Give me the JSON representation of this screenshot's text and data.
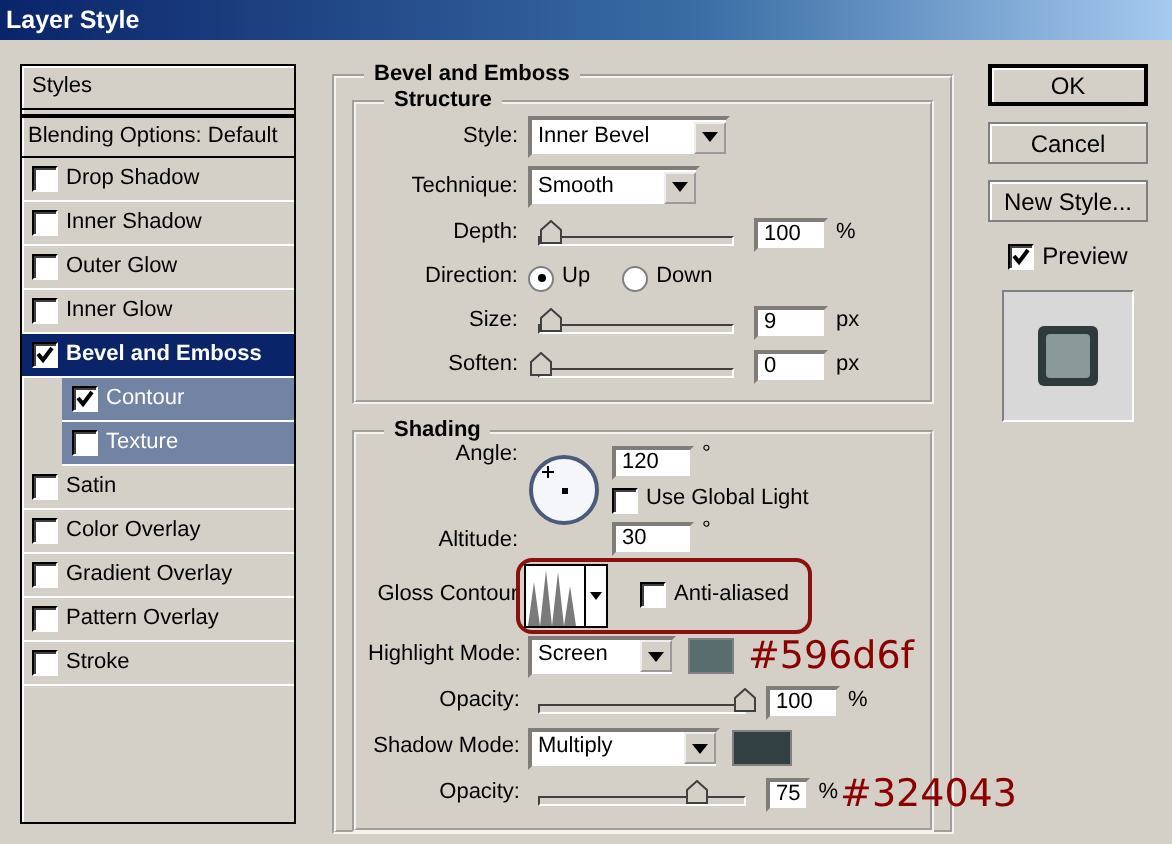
{
  "window": {
    "title": "Layer Style"
  },
  "sidebar": {
    "items": [
      {
        "kind": "header",
        "label": "Styles"
      },
      {
        "kind": "header",
        "label": "Blending Options: Default"
      },
      {
        "kind": "check",
        "label": "Drop Shadow",
        "checked": false,
        "selected": false
      },
      {
        "kind": "check",
        "label": "Inner Shadow",
        "checked": false,
        "selected": false
      },
      {
        "kind": "check",
        "label": "Outer Glow",
        "checked": false,
        "selected": false
      },
      {
        "kind": "check",
        "label": "Inner Glow",
        "checked": false,
        "selected": false
      },
      {
        "kind": "check",
        "label": "Bevel and Emboss",
        "checked": true,
        "selected": true,
        "children": [
          {
            "kind": "check",
            "label": "Contour",
            "checked": true,
            "selected": false
          },
          {
            "kind": "check",
            "label": "Texture",
            "checked": false,
            "selected": false
          }
        ]
      },
      {
        "kind": "check",
        "label": "Satin",
        "checked": false,
        "selected": false
      },
      {
        "kind": "check",
        "label": "Color Overlay",
        "checked": false,
        "selected": false
      },
      {
        "kind": "check",
        "label": "Gradient Overlay",
        "checked": false,
        "selected": false
      },
      {
        "kind": "check",
        "label": "Pattern Overlay",
        "checked": false,
        "selected": false
      },
      {
        "kind": "check",
        "label": "Stroke",
        "checked": false,
        "selected": false
      }
    ]
  },
  "panel": {
    "title": "Bevel and Emboss",
    "structure": {
      "title": "Structure",
      "rows": [
        {
          "kind": "select",
          "label": "Style:",
          "value": "Inner Bevel"
        },
        {
          "kind": "select",
          "label": "Technique:",
          "value": "Smooth"
        },
        {
          "kind": "slider",
          "label": "Depth:",
          "level": 0.05,
          "value": "100",
          "unit": "%"
        },
        {
          "kind": "radio",
          "label": "Direction:",
          "options": [
            {
              "label": "Up",
              "selected": true
            },
            {
              "label": "Down",
              "selected": false
            }
          ]
        },
        {
          "kind": "slider",
          "label": "Size:",
          "level": 0.05,
          "value": "9",
          "unit": "px"
        },
        {
          "kind": "slider",
          "label": "Soften:",
          "level": 0,
          "value": "0",
          "unit": "px"
        }
      ]
    },
    "shading": {
      "title": "Shading",
      "angle": {
        "label": "Angle:",
        "value": "120",
        "unit": "°"
      },
      "use_global_light": {
        "label": "Use Global Light",
        "checked": false
      },
      "altitude": {
        "label": "Altitude:",
        "value": "30",
        "unit": "°"
      },
      "gloss_contour": {
        "label": "Gloss Contour",
        "anti_aliased": {
          "label": "Anti-aliased",
          "checked": false
        }
      },
      "rows": [
        {
          "kind": "mode",
          "label": "Highlight Mode:",
          "value": "Screen",
          "color": "#596d6f",
          "annotation": "#596d6f"
        },
        {
          "kind": "slider",
          "label": "Opacity:",
          "level": 1,
          "value": "100",
          "unit": "%"
        },
        {
          "kind": "mode",
          "label": "Shadow Mode:",
          "value": "Multiply",
          "color": "#324043"
        },
        {
          "kind": "slider",
          "label": "Opacity:",
          "level": 0.76,
          "value": "75",
          "unit": "%",
          "annotation": "#324043"
        }
      ]
    }
  },
  "buttons": [
    {
      "label": "OK",
      "default": true
    },
    {
      "label": "Cancel",
      "default": false
    },
    {
      "label": "New Style...",
      "default": false
    }
  ],
  "preview": {
    "label": "Preview",
    "checked": true
  }
}
